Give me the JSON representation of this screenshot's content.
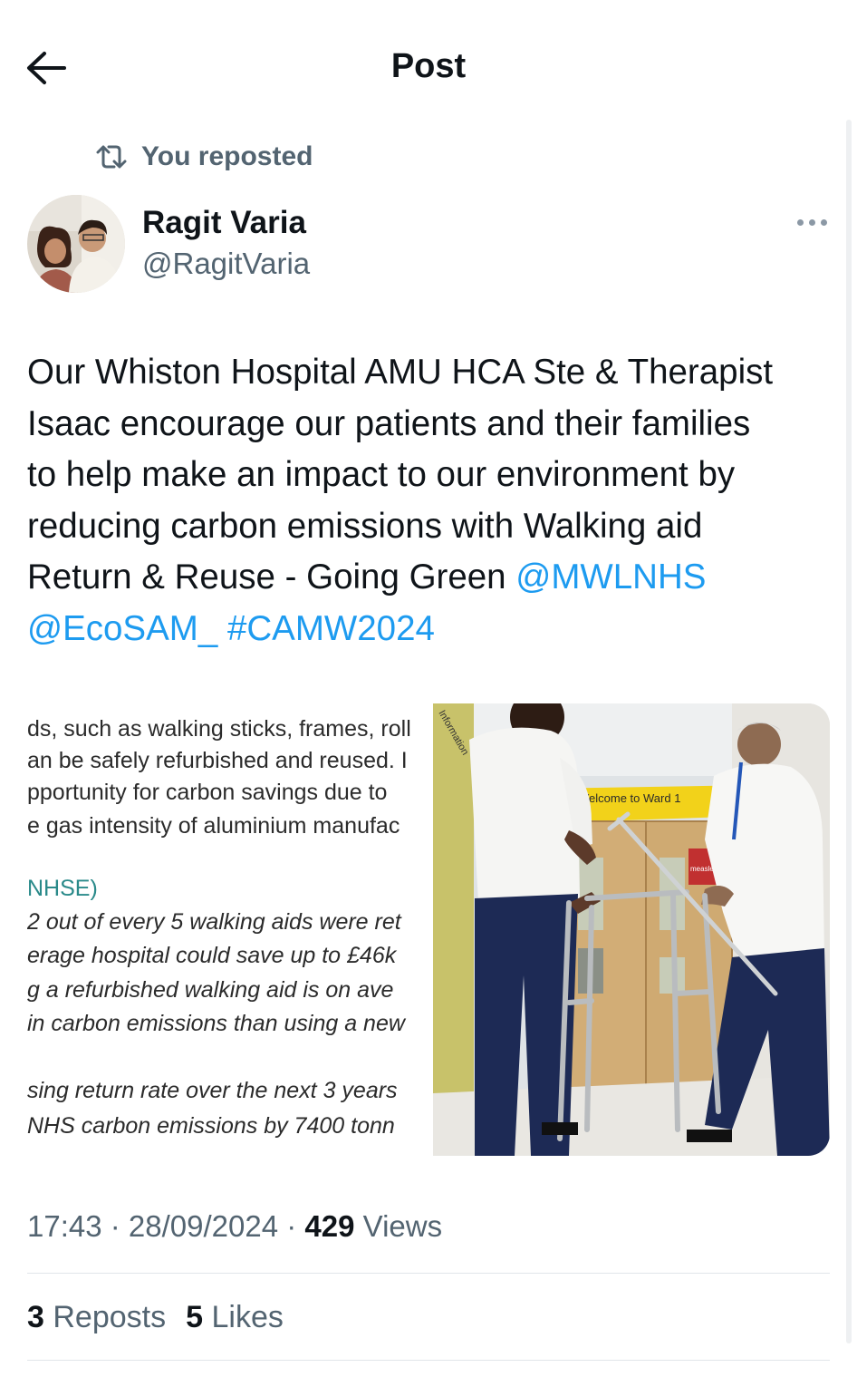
{
  "header": {
    "title": "Post",
    "back_icon": "arrow-left-icon"
  },
  "repost_banner": {
    "icon": "repost-icon",
    "text": "You reposted"
  },
  "author": {
    "name": "Ragit Varia",
    "handle": "@RagitVaria"
  },
  "more_icon": "more-options-icon",
  "tweet": {
    "line1": "Our Whiston Hospital AMU HCA Ste & Therapist",
    "line2": "Isaac encourage our patients and their families",
    "line3": "to help make an impact to our environment by",
    "line4": "reducing carbon emissions with Walking aid",
    "line5_text": "Return & Reuse - Going Green ",
    "mention1": "@MWLNHS",
    "mention2": "@EcoSAM_",
    "hashtag": "#CAMW2024"
  },
  "media": {
    "doc_lines": [
      "ds, such as walking sticks, frames, roll",
      "an be safely refurbished and reused. I",
      "pportunity for carbon savings due to",
      "e gas intensity of aluminium manufac",
      "NHSE)",
      "2 out of every 5 walking aids were ret",
      "erage hospital could save up to £46k",
      "g a refurbished walking aid is on ave",
      "in carbon emissions than using a new",
      "sing return rate over the next 3 years",
      "NHS carbon emissions by 7400 tonn"
    ],
    "ward_sign": "Welcome to Ward 1",
    "info_sign": "Information",
    "measles_sign": "measles"
  },
  "meta": {
    "time": "17:43",
    "sep1": " · ",
    "date": "28/09/2024",
    "sep2": " · ",
    "views_count": "429",
    "views_label": " Views"
  },
  "stats": {
    "reposts_count": "3",
    "reposts_label": " Reposts",
    "likes_count": "5",
    "likes_label": " Likes"
  },
  "colors": {
    "accent": "#1d9bf0",
    "secondary_text": "#536471",
    "text": "#0f1419",
    "divider": "#e1e6ea"
  }
}
